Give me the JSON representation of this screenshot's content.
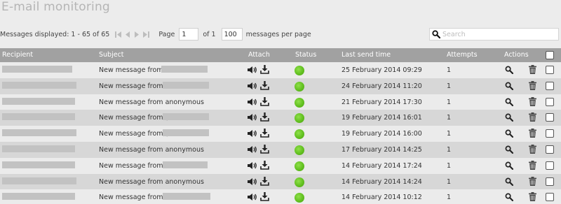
{
  "page": {
    "title": "E-mail monitoring"
  },
  "pager": {
    "displayed_text": "Messages displayed: 1 - 65 of 65",
    "page_label": "Page",
    "page_value": "1",
    "of_label": "of 1",
    "per_page_value": "100",
    "per_page_label": "messages per page"
  },
  "search": {
    "placeholder": "Search"
  },
  "columns": {
    "recipient": "Recipient",
    "subject": "Subject",
    "attach": "Attach",
    "status": "Status",
    "last_send_time": "Last send time",
    "attempts": "Attempts",
    "actions": "Actions"
  },
  "rows": [
    {
      "subject": "New message from",
      "last_send_time": "25 February 2014 09:29",
      "attempts": "1",
      "status": "sent"
    },
    {
      "subject": "New message from",
      "last_send_time": "24 February 2014 11:20",
      "attempts": "1",
      "status": "sent"
    },
    {
      "subject": "New message from anonymous",
      "last_send_time": "21 February 2014 17:30",
      "attempts": "1",
      "status": "sent"
    },
    {
      "subject": "New message from (",
      "last_send_time": "19 February 2014 16:01",
      "attempts": "1",
      "status": "sent"
    },
    {
      "subject": "New message from (",
      "last_send_time": "19 February 2014 16:00",
      "attempts": "1",
      "status": "sent"
    },
    {
      "subject": "New message from anonymous",
      "last_send_time": "17 February 2014 14:25",
      "attempts": "1",
      "status": "sent"
    },
    {
      "subject": "New message from",
      "last_send_time": "14 February 2014 17:24",
      "attempts": "1",
      "status": "sent"
    },
    {
      "subject": "New message from anonymous",
      "last_send_time": "14 February 2014 14:24",
      "attempts": "1",
      "status": "sent"
    },
    {
      "subject": "New message from",
      "last_send_time": "14 February 2014 10:12",
      "attempts": "1",
      "status": "sent"
    }
  ],
  "icons": {
    "nav": [
      "first-page-icon",
      "prev-page-icon",
      "next-page-icon",
      "last-page-icon"
    ],
    "search": "search-icon",
    "attach": [
      "audio-icon",
      "download-icon"
    ],
    "actions": [
      "view-icon",
      "trash-icon"
    ]
  },
  "colors": {
    "header_bg": "#a1a1a1",
    "row_odd": "#ebebeb",
    "row_even": "#d7d7d7",
    "status_ok": "#62c020",
    "title": "#b5b5b5"
  }
}
